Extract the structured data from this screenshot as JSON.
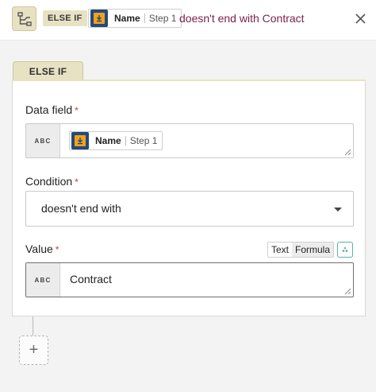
{
  "header": {
    "branch_icon": "branch-icon",
    "badge": "ELSE IF",
    "pill": {
      "name": "Name",
      "step": "Step 1",
      "app_icon": "download-app-icon"
    },
    "condition_text": "doesn't end with Contract",
    "close_icon": "close-icon"
  },
  "panel": {
    "tab_label": "ELSE IF",
    "data_field": {
      "label": "Data field",
      "required_mark": "*",
      "type_badge": "ABC",
      "pill": {
        "name": "Name",
        "step": "Step 1"
      }
    },
    "condition": {
      "label": "Condition",
      "required_mark": "*",
      "selected": "doesn't end with"
    },
    "value": {
      "label": "Value",
      "required_mark": "*",
      "mode_options": [
        "Text",
        "Formula"
      ],
      "active_mode": "Text",
      "type_badge": "ABC",
      "text": "Contract"
    }
  },
  "add_button_label": "+",
  "colors": {
    "accent_tan": "#e7e2c3",
    "condition_text": "#7b1f4b",
    "required": "#d0343a",
    "formula_icon": "#58b3a3"
  }
}
